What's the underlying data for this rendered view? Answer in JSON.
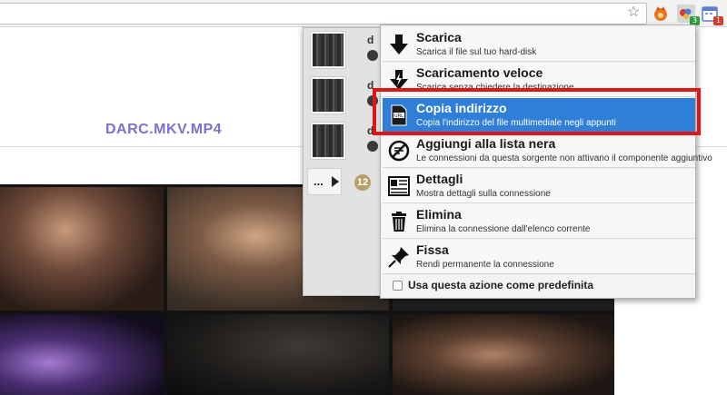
{
  "browser": {
    "extensions": [
      {
        "icon": "fox-icon",
        "badge": ""
      },
      {
        "icon": "download-helper-icon",
        "badge": "3",
        "badge_color": "#2e9c3e"
      },
      {
        "icon": "calendar-icon",
        "badge": "1",
        "badge_color": "#d83a2e"
      }
    ]
  },
  "page": {
    "file_title": "DARC.MKV.MP4"
  },
  "popup": {
    "entries": [
      {
        "name": "d"
      },
      {
        "name": "d"
      },
      {
        "name": "d"
      }
    ],
    "more_label": "...",
    "count": "12"
  },
  "menu": {
    "items": [
      {
        "title": "Scarica",
        "desc": "Scarica il file sul tuo hard-disk",
        "icon": "download-arrow-icon"
      },
      {
        "title": "Scaricamento veloce",
        "desc": "Scarica senza chiedere la destinazione",
        "icon": "quick-download-icon"
      },
      {
        "title": "Copia indirizzo",
        "desc": "Copia l'indirizzo del file multimediale negli appunti",
        "icon": "copy-url-icon",
        "active": true
      },
      {
        "title": "Aggiungi alla lista nera",
        "desc": "Le connessioni da questa sorgente non attivano il componente aggiuntivo",
        "icon": "blacklist-icon"
      },
      {
        "title": "Dettagli",
        "desc": "Mostra dettagli sulla connessione",
        "icon": "details-icon"
      },
      {
        "title": "Elimina",
        "desc": "Elimina la connessione dall'elenco corrente",
        "icon": "trash-icon"
      },
      {
        "title": "Fissa",
        "desc": "Rendi permanente la connessione",
        "icon": "pin-icon"
      }
    ],
    "default_label": "Usa questa azione come predefinita"
  },
  "colors": {
    "accent": "#2f7fd8",
    "highlight": "#e01515",
    "title": "#7e6fd0"
  }
}
